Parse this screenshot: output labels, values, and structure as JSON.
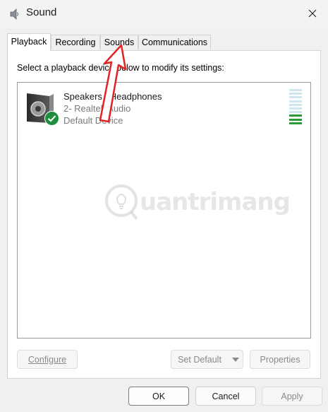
{
  "window": {
    "title": "Sound"
  },
  "tabs": [
    {
      "label": "Playback",
      "active": true
    },
    {
      "label": "Recording",
      "active": false
    },
    {
      "label": "Sounds",
      "active": false
    },
    {
      "label": "Communications",
      "active": false
    }
  ],
  "instruction": "Select a playback device below to modify its settings:",
  "device": {
    "name": "Speakers / Headphones",
    "subtitle": "2- Realtek Audio",
    "status": "Default Device",
    "icon": "speaker-icon",
    "status_icon": "check-badge-icon",
    "meter_level": 0.25
  },
  "buttons": {
    "configure": "Configure",
    "set_default": "Set Default",
    "properties": "Properties",
    "ok": "OK",
    "cancel": "Cancel",
    "apply": "Apply"
  },
  "watermark": {
    "text": "uantrimang"
  },
  "colors": {
    "accent_green": "#1e8e3e",
    "meter_empty": "#cfe6ee",
    "meter_full": "#2e9b3a",
    "annotation_red": "#e02424"
  }
}
